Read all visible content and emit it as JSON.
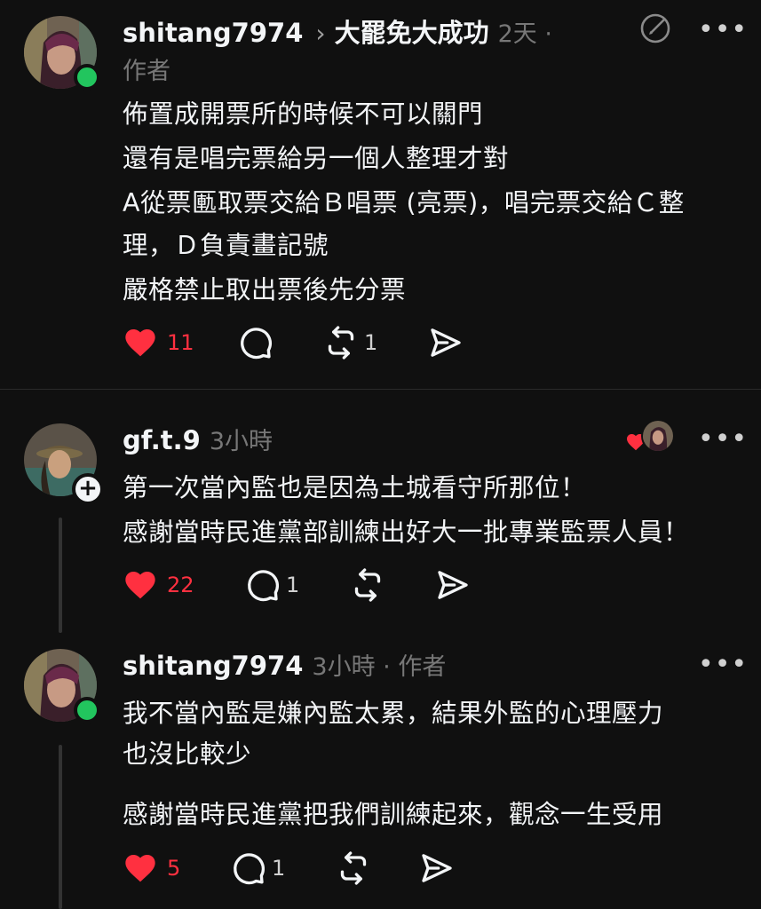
{
  "posts": [
    {
      "username": "shitang7974",
      "thread_title": "大罷免大成功",
      "time": "2天 ·",
      "author_tag": "作者",
      "lines": [
        "佈置成開票所的時候不可以關門",
        "還有是唱完票給另一個人整理才對",
        "A從票匭取票交給Ｂ唱票 (亮票)，唱完票交給Ｃ整",
        "理，Ｄ負責畫記號",
        "嚴格禁止取出票後先分票"
      ],
      "likes": "11",
      "replies": "",
      "reposts": "1",
      "online": true
    },
    {
      "username": "gf.t.9",
      "time": "3小時",
      "lines": [
        "第一次當內監也是因為土城看守所那位！",
        "感謝當時民進黨部訓練出好大一批專業監票人員！"
      ],
      "likes": "22",
      "replies": "1",
      "reposts": "",
      "follow_symbol": "+"
    },
    {
      "username": "shitang7974",
      "time": "3小時 · 作者",
      "lines": [
        "我不當內監是嫌內監太累，結果外監的心理壓力",
        "也沒比較少",
        "感謝當時民進黨把我們訓練起來，觀念一生受用"
      ],
      "likes": "5",
      "replies": "1",
      "reposts": "",
      "online": true
    }
  ],
  "more_label": "•••",
  "colors": {
    "background": "#101010",
    "like_red": "#ff3040",
    "online_green": "#22c55e",
    "muted": "#777777"
  },
  "icons": [
    "heart-icon",
    "comment-icon",
    "repost-icon",
    "share-icon",
    "edit-icon",
    "more-icon",
    "chevron-right-icon",
    "plus-icon"
  ]
}
